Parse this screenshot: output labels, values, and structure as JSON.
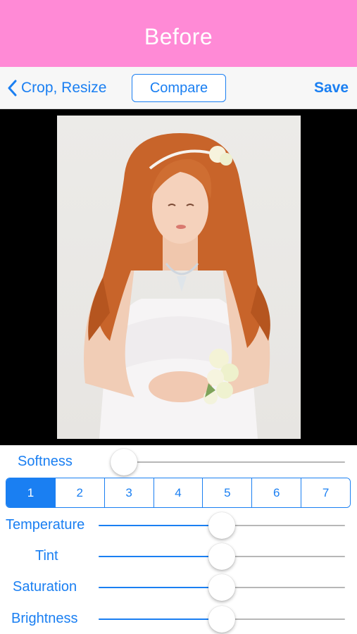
{
  "header": {
    "title": "Before",
    "background": "#ff8ad6"
  },
  "toolbar": {
    "back_label": "Crop, Resize",
    "back_icon": "chevron-left-icon",
    "compare_label": "Compare",
    "save_label": "Save"
  },
  "photo": {
    "subject": "bride-portrait"
  },
  "controls": {
    "softness": {
      "label": "Softness",
      "value": 0.0
    },
    "segments": {
      "items": [
        "1",
        "2",
        "3",
        "4",
        "5",
        "6",
        "7"
      ],
      "selected": "1"
    },
    "temperature": {
      "label": "Temperature",
      "value": 0.5
    },
    "tint": {
      "label": "Tint",
      "value": 0.5
    },
    "saturation": {
      "label": "Saturation",
      "value": 0.5
    },
    "brightness": {
      "label": "Brightness",
      "value": 0.5
    }
  },
  "colors": {
    "accent": "#1a7ff2",
    "track": "#b7b7b7"
  }
}
